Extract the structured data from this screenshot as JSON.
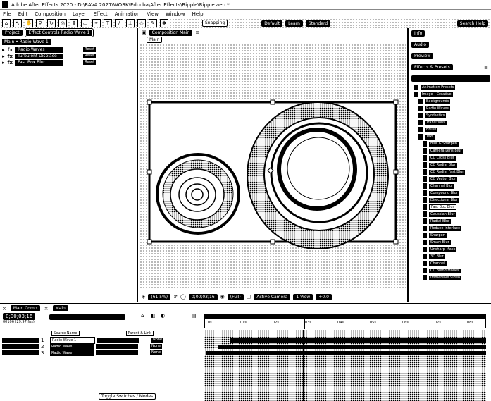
{
  "titlebar": {
    "title": "Adobe After Effects 2020 - D:\\RAVA 2021\\WORK\\Educba\\After Effects\\Ripple\\Ripple.aep *"
  },
  "menu": [
    "File",
    "Edit",
    "Composition",
    "Layer",
    "Effect",
    "Animation",
    "View",
    "Window",
    "Help"
  ],
  "toolbar": {
    "snapping": "Snapping",
    "workspaces": [
      "Default",
      "Learn",
      "Standard"
    ],
    "search_placeholder": "Search Help"
  },
  "left_panel": {
    "tabs": {
      "project": "Project",
      "effect_controls": "Effect Controls Radio Wave 1"
    },
    "header": "Main • Radio Wave 1",
    "effects": [
      {
        "name": "Radio Waves",
        "reset": "Reset"
      },
      {
        "name": "Turbulent Displace",
        "reset": "Reset"
      },
      {
        "name": "Fast Box Blur",
        "reset": "Reset"
      }
    ]
  },
  "comp_panel": {
    "tab": "Composition Main",
    "sub_tab": "Main",
    "zoom": "(61.5%)",
    "timecode": "0;00;03;16",
    "resolution": "(Full)",
    "camera": "Active Camera",
    "views": "1 View",
    "exposure": "+0.0"
  },
  "right_panel": {
    "sections": [
      "Info",
      "Audio",
      "Preview"
    ],
    "effects_title": "Effects & Presets",
    "tree": [
      {
        "label": "Animation Presets",
        "highlight": false
      },
      {
        "label": "Image - Creative",
        "highlight": false
      },
      {
        "label": "Backgrounds",
        "highlight": false
      },
      {
        "label": "Radio Waves",
        "highlight": false
      },
      {
        "label": "Synthetics",
        "highlight": false
      },
      {
        "label": "Transitions",
        "highlight": false
      },
      {
        "label": "Brush",
        "highlight": false
      },
      {
        "label": "Text",
        "highlight": false
      },
      {
        "label": "Blur & Sharpen",
        "highlight": false
      },
      {
        "label": "Camera Lens Blur",
        "highlight": false
      },
      {
        "label": "CC Cross Blur",
        "highlight": false
      },
      {
        "label": "CC Radial Blur",
        "highlight": false
      },
      {
        "label": "CC Radial Fast Blur",
        "highlight": false
      },
      {
        "label": "CC Vector Blur",
        "highlight": false
      },
      {
        "label": "Channel Blur",
        "highlight": false
      },
      {
        "label": "Compound Blur",
        "highlight": false
      },
      {
        "label": "Directional Blur",
        "highlight": false
      },
      {
        "label": "Fast Box Blur",
        "highlight": true
      },
      {
        "label": "Gaussian Blur",
        "highlight": false
      },
      {
        "label": "Radial Blur",
        "highlight": false
      },
      {
        "label": "Reduce Interlace",
        "highlight": false
      },
      {
        "label": "Sharpen",
        "highlight": false
      },
      {
        "label": "Smart Blur",
        "highlight": false
      },
      {
        "label": "Unsharp Mask",
        "highlight": false
      },
      {
        "label": "3D Blur",
        "highlight": false
      },
      {
        "label": "Channel",
        "highlight": false
      },
      {
        "label": "CC Blend Modes",
        "highlight": false
      },
      {
        "label": "Immersive Video",
        "highlight": false
      }
    ]
  },
  "timeline": {
    "tabs": [
      "Main Comp",
      "Main"
    ],
    "timecode": "0;00;03;16",
    "frame_info": "00106 (29.97 fps)",
    "search_placeholder": "",
    "columns": {
      "source": "Source Name",
      "parent": "Parent & Link"
    },
    "layers": [
      {
        "num": "1",
        "name": "Radio Wave 1",
        "selected": true,
        "parent": "None"
      },
      {
        "num": "2",
        "name": "Radio Wave",
        "selected": false,
        "parent": "None"
      },
      {
        "num": "3",
        "name": "Radio Wave",
        "selected": false,
        "parent": "None"
      }
    ],
    "ruler": [
      "0s",
      "01s",
      "02s",
      "03s",
      "04s",
      "05s",
      "06s",
      "07s",
      "08s"
    ],
    "footer": "Toggle Switches / Modes"
  }
}
